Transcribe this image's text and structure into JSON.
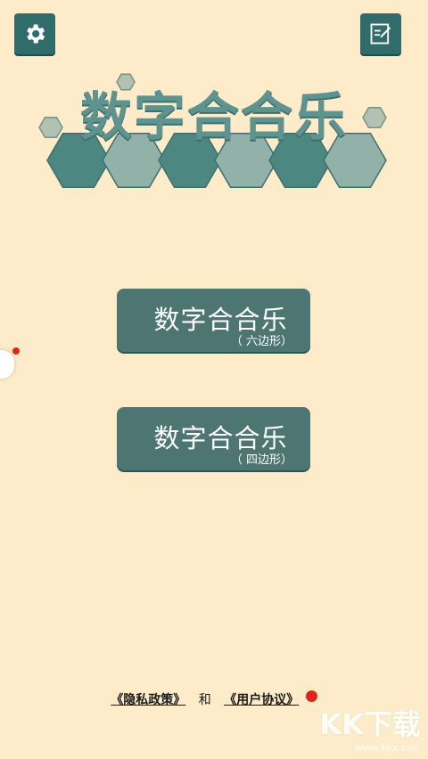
{
  "header": {
    "settings_icon": "gear-icon",
    "notes_icon": "edit-note-icon"
  },
  "title": "数字合合乐",
  "menu": [
    {
      "label": "数字合合乐",
      "sub": "（ 六边形）"
    },
    {
      "label": "数字合合乐",
      "sub": "（ 四边形）"
    }
  ],
  "footer": {
    "privacy": "《隐私政策》",
    "conjunction": "和",
    "agreement": "《用户协议》"
  },
  "watermark": {
    "text": "KK下载",
    "url": "www.kkx.net"
  },
  "colors": {
    "background": "#fdebc9",
    "button": "#4d7673",
    "hex_dark": "#4d8782",
    "hex_light": "#92b1a9",
    "notification": "#e0261b"
  }
}
